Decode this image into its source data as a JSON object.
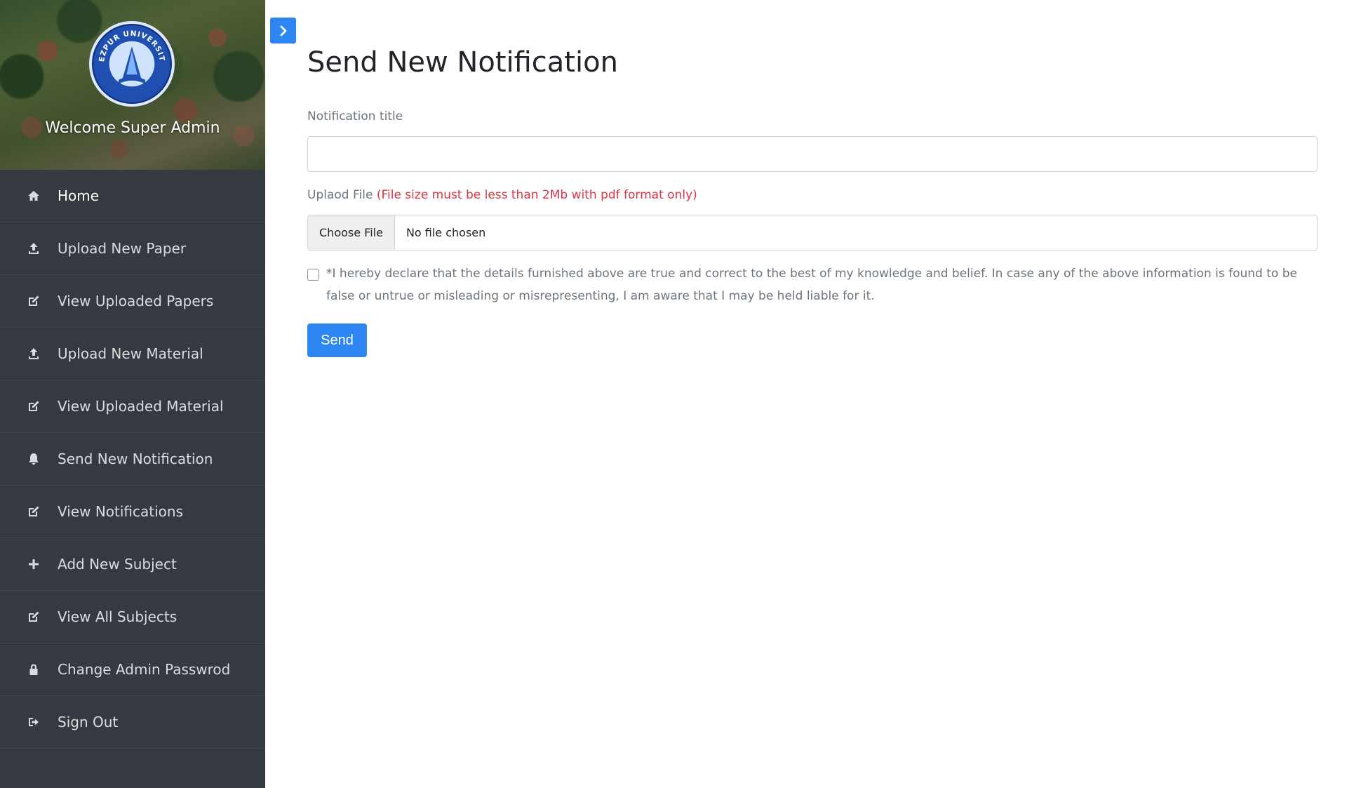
{
  "sidebar": {
    "welcome": "Welcome Super Admin",
    "logo_alt": "TEZPUR UNIVERSITY",
    "items": [
      {
        "label": "Home",
        "icon": "home-icon",
        "active": true
      },
      {
        "label": "Upload New Paper",
        "icon": "upload-icon"
      },
      {
        "label": "View Uploaded Papers",
        "icon": "edit-icon"
      },
      {
        "label": "Upload New Material",
        "icon": "upload-icon"
      },
      {
        "label": "View Uploaded Material",
        "icon": "edit-icon"
      },
      {
        "label": "Send New Notification",
        "icon": "bell-icon"
      },
      {
        "label": "View Notifications",
        "icon": "edit-icon"
      },
      {
        "label": "Add New Subject",
        "icon": "plus-icon"
      },
      {
        "label": "View All Subjects",
        "icon": "edit-icon"
      },
      {
        "label": "Change Admin Passwrod",
        "icon": "lock-icon"
      },
      {
        "label": "Sign Out",
        "icon": "sign-out-icon"
      }
    ]
  },
  "main": {
    "title": "Send New Notification",
    "title_label": "Notification title",
    "title_value": "",
    "upload_label": "Uplaod File",
    "upload_note": "(File size must be less than 2Mb with pdf format only)",
    "file_button": "Choose File",
    "file_status": "No file chosen",
    "declaration": "*I hereby declare that the details furnished above are true and correct to the best of my knowledge and belief. In case any of the above information is found to be false or untrue or misleading or misrepresenting, I am aware that I may be held liable for it.",
    "send_label": "Send"
  },
  "colors": {
    "accent": "#2e86f3",
    "sidebar_bg": "#343a40",
    "note_red": "#dc3545"
  }
}
